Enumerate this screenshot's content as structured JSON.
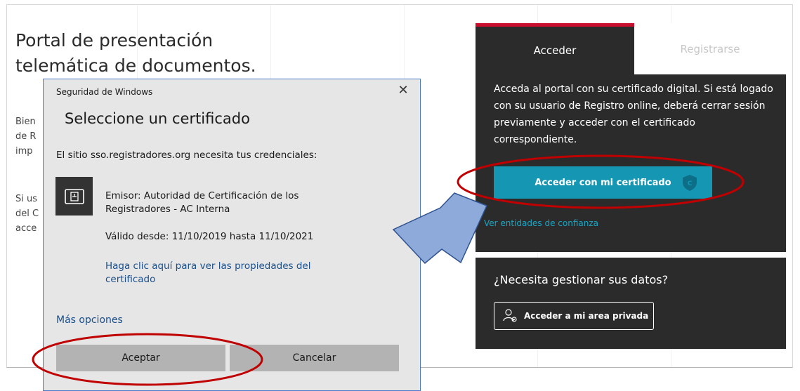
{
  "page": {
    "title": "Portal de presentación telemática de documentos.",
    "bg_para_1": [
      "Bien",
      "de R",
      "imp"
    ],
    "bg_para_2": [
      "Si us",
      "del C",
      "acce"
    ]
  },
  "login": {
    "tabs": [
      {
        "label": "Acceder",
        "active": true
      },
      {
        "label": "Registrarse",
        "active": false
      }
    ],
    "description": "Acceda al portal con su certificado digital. Si está logado con su usuario de Registro online, deberá cerrar sesión previamente y acceder con el certificado correspondiente.",
    "cert_button": "Acceder con mi certificado",
    "trust_link": "Ver entidades de confianza",
    "shield_letter": "C"
  },
  "data_panel": {
    "title": "¿Necesita gestionar sus datos?",
    "private_button": "Acceder a mi area privada"
  },
  "dialog": {
    "window_title": "Seguridad de Windows",
    "close_glyph": "✕",
    "heading": "Seleccione un certificado",
    "subtitle": "El sitio sso.registradores.org necesita tus credenciales:",
    "issuer_line_1": "Emisor: Autoridad de Certificación de los",
    "issuer_line_2": "Registradores - AC Interna",
    "validity": "Válido desde: 11/10/2019 hasta 11/10/2021",
    "properties_link": "Haga clic aquí para ver las propiedades del certificado",
    "more_options": "Más opciones",
    "ok_button": "Aceptar",
    "cancel_button": "Cancelar"
  },
  "colors": {
    "panel_bg": "#2b2b2b",
    "accent_red": "#c8102e",
    "button_teal": "#1597b3",
    "link_teal": "#18a6c6",
    "dialog_bg": "#e6e6e6",
    "annotation_red": "#c00000",
    "arrow_fill": "#8eaadb"
  },
  "icons": {
    "close": "close-icon",
    "certificate": "certificate-icon",
    "shield": "shield-icon",
    "user_settings": "user-gear-icon"
  }
}
